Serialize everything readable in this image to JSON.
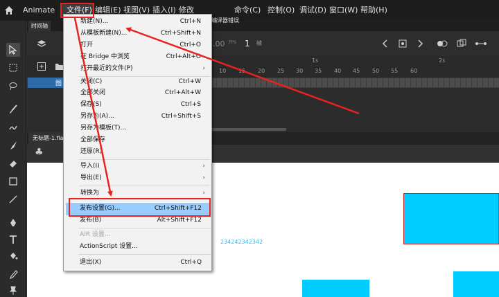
{
  "menubar": {
    "app_name": "Animate",
    "items": [
      "文件(F)",
      "编辑(E)",
      "视图(V)",
      "插入(I)",
      "修改",
      "命令(C)",
      "控制(O)",
      "调试(D)",
      "窗口(W)",
      "帮助(H)"
    ]
  },
  "timeline": {
    "tab": "时间轴",
    "compiler_tab": "编译器错误",
    "fps": ".00",
    "fps_unit": "FPS",
    "frame": "1",
    "frame_unit": "帧",
    "sec_marks": [
      "1s",
      "2s"
    ],
    "ruler": [
      "10",
      "15",
      "20",
      "25",
      "30",
      "35",
      "40",
      "45",
      "50",
      "55",
      "60"
    ],
    "layer_name": "图"
  },
  "document": {
    "tab": "无标题-1.fla",
    "stage_text": "234242342342"
  },
  "file_menu": {
    "items": [
      {
        "label": "新建(N)...",
        "shortcut": "Ctrl+N"
      },
      {
        "label": "从模板新建(N)...",
        "shortcut": "Ctrl+Shift+N"
      },
      {
        "label": "打开",
        "shortcut": "Ctrl+O"
      },
      {
        "label": "在 Bridge 中浏览",
        "shortcut": "Ctrl+Alt+O"
      },
      {
        "label": "打开最近的文件(P)",
        "shortcut": ""
      },
      {
        "label": "关闭(C)",
        "shortcut": "Ctrl+W"
      },
      {
        "label": "全部关闭",
        "shortcut": "Ctrl+Alt+W"
      },
      {
        "label": "保存(S)",
        "shortcut": "Ctrl+S"
      },
      {
        "label": "另存为(A)...",
        "shortcut": "Ctrl+Shift+S"
      },
      {
        "label": "另存为模板(T)...",
        "shortcut": ""
      },
      {
        "label": "全部保存",
        "shortcut": ""
      },
      {
        "label": "还原(R)",
        "shortcut": ""
      },
      {
        "label": "导入(I)",
        "shortcut": ""
      },
      {
        "label": "导出(E)",
        "shortcut": ""
      },
      {
        "label": "转换为",
        "shortcut": ""
      },
      {
        "label": "发布设置(G)...",
        "shortcut": "Ctrl+Shift+F12"
      },
      {
        "label": "发布(B)",
        "shortcut": "Alt+Shift+F12"
      },
      {
        "label": "AIR 设置...",
        "shortcut": ""
      },
      {
        "label": "ActionScript 设置...",
        "shortcut": ""
      },
      {
        "label": "退出(X)",
        "shortcut": "Ctrl+Q"
      }
    ]
  },
  "colors": {
    "annotation": "#e8231f",
    "highlight": "#99ccff",
    "shape_fill": "#00ccff"
  }
}
